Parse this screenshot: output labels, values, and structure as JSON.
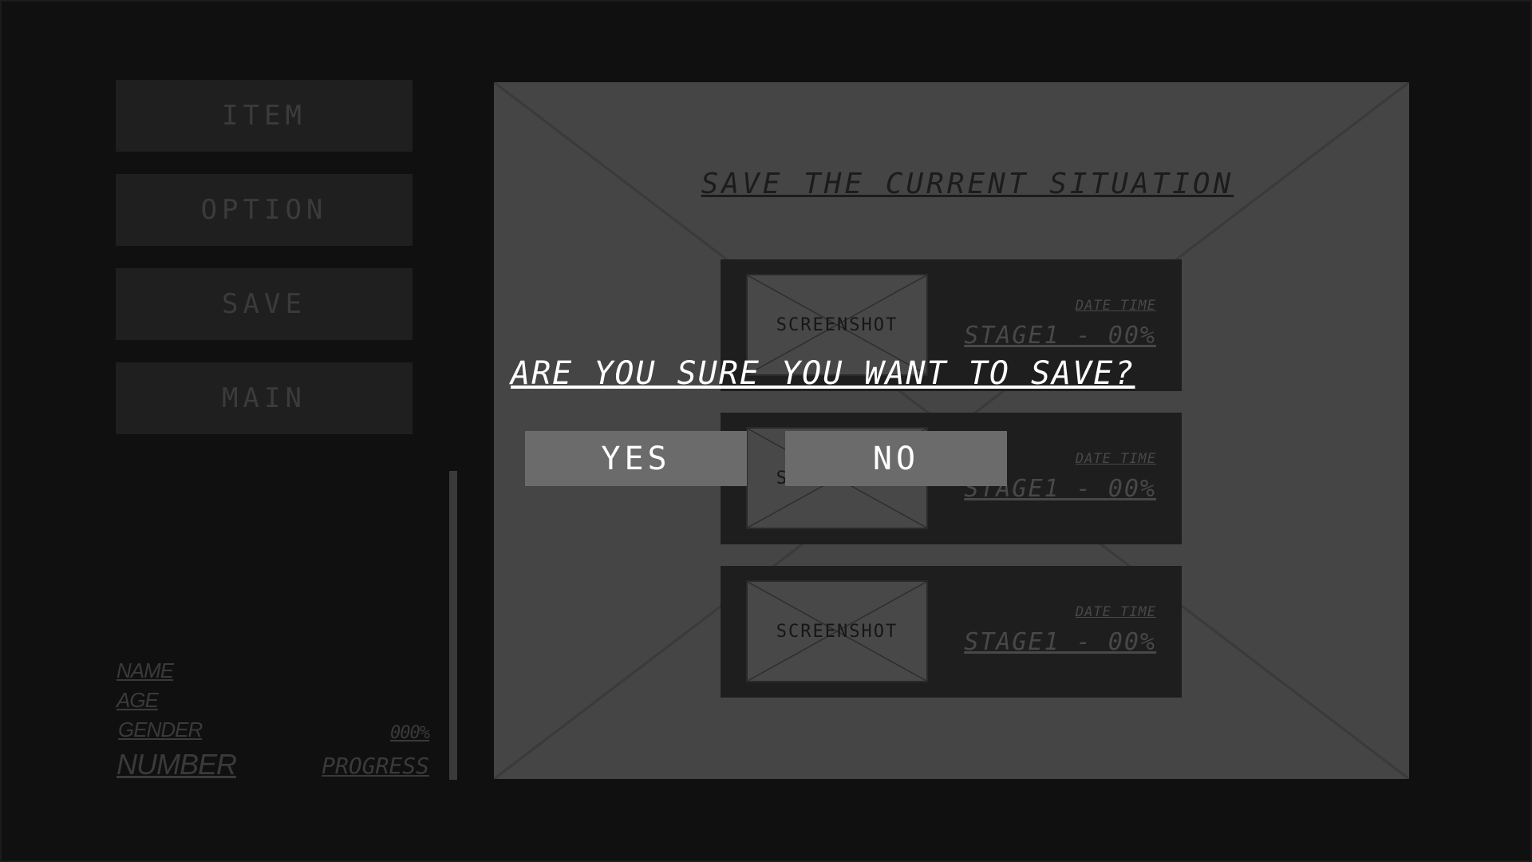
{
  "menu": {
    "item": "ITEM",
    "option": "OPTION",
    "save": "SAVE",
    "main": "MAIN"
  },
  "player_info": {
    "name": "NAME",
    "age": "AGE",
    "gender": "GENDER",
    "number": "NUMBER",
    "percent": "000%",
    "progress": "PROGRESS"
  },
  "save_panel": {
    "title": "SAVE THE CURRENT SITUATION",
    "slots": [
      {
        "thumb_label": "SCREENSHOT",
        "date": "DATE TIME",
        "stage": "STAGE1 - 00%"
      },
      {
        "thumb_label": "SCREENSHOT",
        "date": "DATE TIME",
        "stage": "STAGE1 - 00%"
      },
      {
        "thumb_label": "SCREENSHOT",
        "date": "DATE TIME",
        "stage": "STAGE1 - 00%"
      }
    ]
  },
  "dialog": {
    "question": "ARE YOU SURE YOU WANT TO SAVE?",
    "yes": "YES",
    "no": "NO"
  },
  "colors": {
    "background": "#101010",
    "panel": "#454545",
    "dialog_button": "#6b6b6b"
  }
}
